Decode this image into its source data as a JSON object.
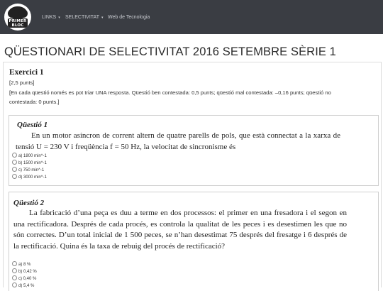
{
  "navbar": {
    "logo_text_line1": "PRIMER",
    "logo_text_line2": "BLOC",
    "items": [
      {
        "label": "LINKS",
        "caret": "▾"
      },
      {
        "label": "SELECTIVITAT",
        "caret": "▾"
      },
      {
        "label": "Web de Tecnologia",
        "caret": ""
      }
    ]
  },
  "page": {
    "title": "QÜESTIONARI DE SELECTIVITAT 2016 SETEMBRE SÈRIE 1"
  },
  "exercise": {
    "title": "Exercici 1",
    "points": "[2,5 punts]",
    "instructions": "[En cada qüestió només es pot triar UNA resposta. Qüestió ben contestada: 0,5 punts; qüestió mal contestada: –0,16 punts; qüestió no contestada: 0 punts.]"
  },
  "questions": [
    {
      "title": "Qüestió 1",
      "body": "En un motor asíncron de corrent altern de quatre parells de pols, que està connectat a la xarxa de tensió U = 230 V i freqüència f = 50 Hz, la velocitat de sincronisme és",
      "options": [
        "a) 1800 min^-1",
        "b) 1500 min^-1",
        "c) 750 min^-1",
        "d) 3000 min^-1"
      ]
    },
    {
      "title": "Qüestió 2",
      "body": "La fabricació d’una peça es duu a terme en dos processos: el primer en una fresadora i el segon en una rectificadora. Després de cada procés, es controla la qualitat de les peces i es desestimen les que no són correctes. D’un total inicial de 1 500 peces, se n’han desestimat 75 després del fresatge i 6 després de la rectificació. Quina és la taxa de rebuig del procés de rectificació?",
      "options": [
        "a) 8 %",
        "b) 0,42 %",
        "c) 0,40 %",
        "d) 5,4 %"
      ]
    }
  ]
}
